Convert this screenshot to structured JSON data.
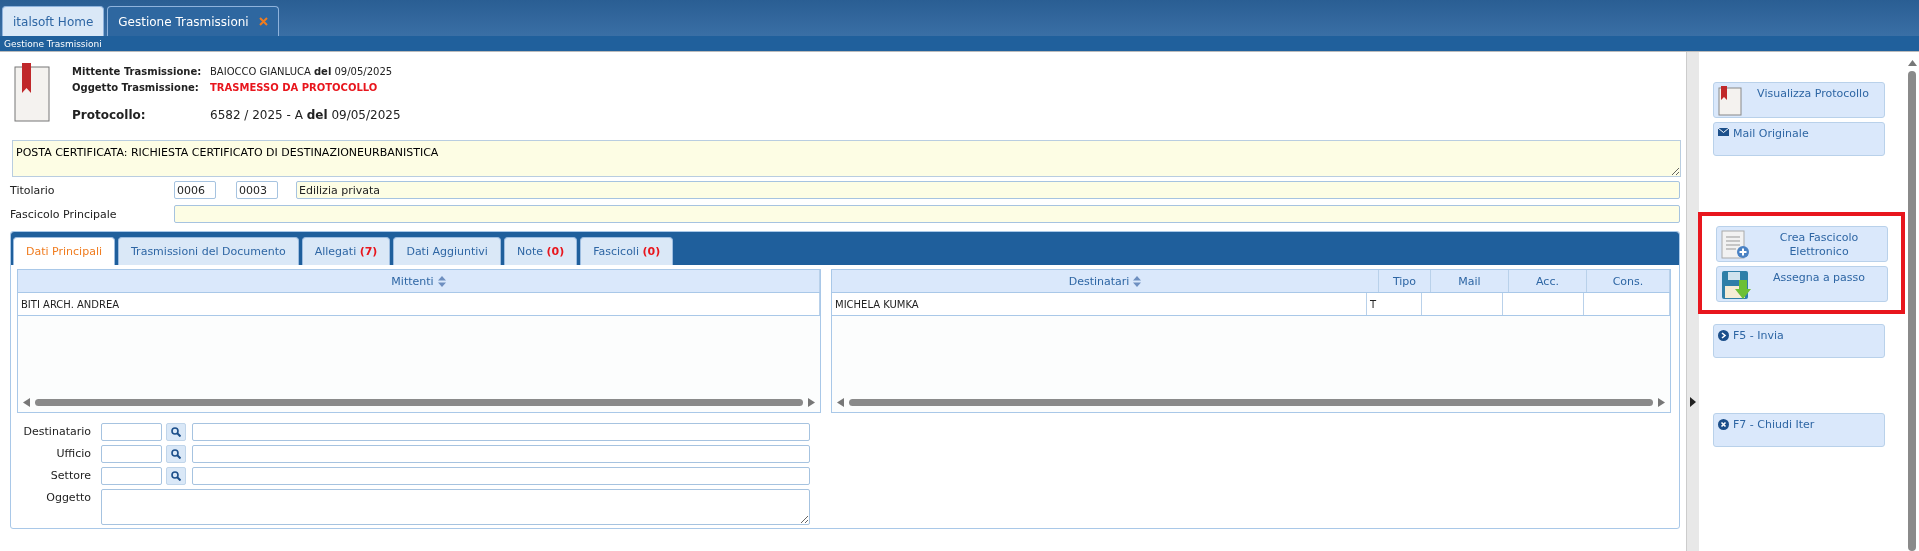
{
  "app_tabs": [
    {
      "label": "italsoft Home",
      "selected": false,
      "closable": false
    },
    {
      "label": "Gestione Trasmissioni",
      "selected": true,
      "closable": true
    }
  ],
  "page_title": "Gestione Trasmissioni",
  "header": {
    "rows": [
      {
        "label": "Mittente Trasmissione:",
        "value": "BAIOCCO GIANLUCA **del** 09/05/2025",
        "kind": "plain"
      },
      {
        "label": "Oggetto Trasmissione:",
        "value": "TRASMESSO DA PROTOCOLLO",
        "kind": "alert"
      }
    ],
    "protocol": {
      "label": "Protocollo:",
      "value": "6582 / 2025 - A **del** 09/05/2025"
    }
  },
  "subject": {
    "value": "POSTA CERTIFICATA: RICHIESTA CERTIFICATO DI DESTINAZIONEURBANISTICA"
  },
  "titolario": {
    "label": "Titolario",
    "code_1": "0006",
    "code_2": "0003",
    "description": "Edilizia privata"
  },
  "fascicolo": {
    "label": "Fascicolo Principale"
  },
  "tabs": [
    {
      "label": "Dati Principali",
      "selected": true
    },
    {
      "label": "Trasmissioni del Documento",
      "selected": false
    },
    {
      "label": "Allegati",
      "count": "(7)",
      "selected": false
    },
    {
      "label": "Dati Aggiuntivi",
      "selected": false
    },
    {
      "label": "Note",
      "count": "(0)",
      "selected": false
    },
    {
      "label": "Fascicoli",
      "count": "(0)",
      "selected": false
    }
  ],
  "mittenti": {
    "columns": [
      "Mittenti"
    ],
    "rows": [
      [
        "BITI ARCH. ANDREA"
      ]
    ]
  },
  "destinatari": {
    "columns": [
      "Destinatari",
      "Tipo",
      "Mail",
      "Acc.",
      "Cons."
    ],
    "rows": [
      [
        "MICHELA KUMKA",
        "T",
        "",
        "",
        ""
      ]
    ]
  },
  "form": {
    "fields": [
      {
        "label": "Destinatario",
        "kind": "lookup"
      },
      {
        "label": "Ufficio",
        "kind": "lookup"
      },
      {
        "label": "Settore",
        "kind": "lookup"
      },
      {
        "label": "Oggetto",
        "kind": "textarea"
      }
    ]
  },
  "side": {
    "groups": [
      {
        "highlighted": false,
        "buttons": [
          {
            "label": "Visualizza Protocollo",
            "kind": "large"
          },
          {
            "label": "Mail Originale",
            "kind": "small"
          }
        ]
      },
      {
        "highlighted": true,
        "buttons": [
          {
            "label": "Crea Fascicolo Elettronico",
            "kind": "large"
          },
          {
            "label": "Assegna a passo",
            "kind": "large"
          }
        ]
      },
      {
        "highlighted": false,
        "buttons": [
          {
            "label": "F5 - Invia",
            "kind": "small"
          }
        ]
      },
      {
        "highlighted": false,
        "buttons": [
          {
            "label": "F7 - Chiudi Iter",
            "kind": "small"
          }
        ]
      }
    ]
  }
}
